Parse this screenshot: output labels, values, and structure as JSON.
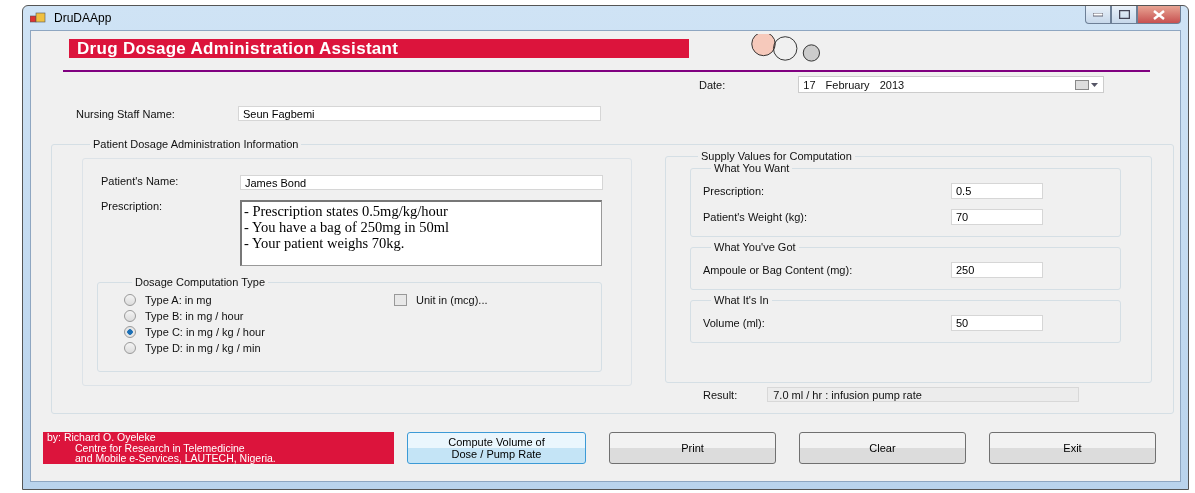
{
  "window": {
    "title": "DruDAApp"
  },
  "banner": {
    "title": "Drug Dosage Administration Assistant"
  },
  "nursing_staff": {
    "label": "Nursing Staff Name:",
    "value": "Seun Fagbemi"
  },
  "date": {
    "label": "Date:",
    "value": "17 February 2013"
  },
  "patient_info": {
    "title": "Patient Dosage Administration Information",
    "patient_name": {
      "label": "Patient's Name:",
      "value": "James Bond"
    },
    "prescription": {
      "label": "Prescription:",
      "lines": [
        "- Prescription states 0.5mg/kg/hour",
        "- You have a bag of 250mg in 50ml",
        "- Your patient weighs 70kg."
      ]
    },
    "computation_type": {
      "title": "Dosage Computation Type",
      "options": [
        {
          "label": "Type A: in mg",
          "selected": false
        },
        {
          "label": "Type B: in mg / hour",
          "selected": false
        },
        {
          "label": "Type C: in mg / kg / hour",
          "selected": true
        },
        {
          "label": "Type D: in mg / kg / min",
          "selected": false
        }
      ],
      "unit_checkbox": {
        "label": "Unit in (mcg)...",
        "checked": false
      }
    }
  },
  "supply": {
    "title": "Supply Values for Computation",
    "groups": [
      {
        "title": "What You Want",
        "fields": [
          {
            "label": "Prescription:",
            "value": "0.5"
          },
          {
            "label": "Patient's Weight (kg):",
            "value": "70"
          }
        ]
      },
      {
        "title": "What You've Got",
        "fields": [
          {
            "label": "Ampoule or Bag Content (mg):",
            "value": "250"
          }
        ]
      },
      {
        "title": "What It's In",
        "fields": [
          {
            "label": "Volume (ml):",
            "value": "50"
          }
        ]
      }
    ]
  },
  "result": {
    "label": "Result:",
    "value": "7.0 ml / hr : infusion pump rate"
  },
  "credit": {
    "lines": [
      "by: Richard O. Oyeleke",
      "Centre for Research in Telemedicine",
      "and Mobile e-Services, LAUTECH, Nigeria."
    ]
  },
  "buttons": [
    {
      "lines": [
        "Compute Volume of",
        "Dose / Pump Rate"
      ],
      "kind": "primary"
    },
    {
      "lines": [
        "Print"
      ],
      "kind": "normal"
    },
    {
      "lines": [
        "Clear"
      ],
      "kind": "normal"
    },
    {
      "lines": [
        "Exit"
      ],
      "kind": "normal"
    }
  ]
}
